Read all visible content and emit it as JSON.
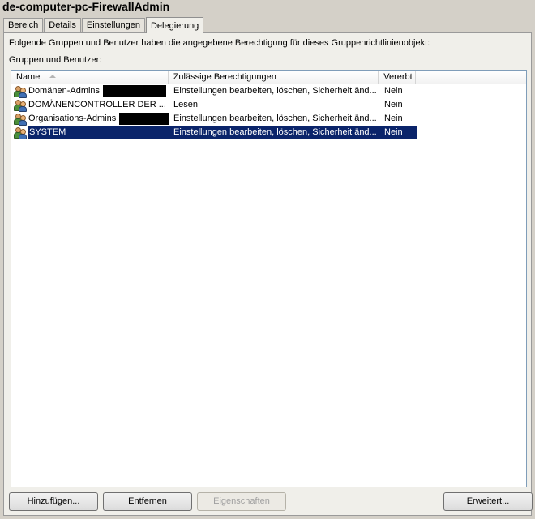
{
  "window": {
    "title": "de-computer-pc-FirewallAdmin"
  },
  "tabs": [
    {
      "label": "Bereich",
      "active": false
    },
    {
      "label": "Details",
      "active": false
    },
    {
      "label": "Einstellungen",
      "active": false
    },
    {
      "label": "Delegierung",
      "active": true
    }
  ],
  "panel": {
    "description": "Folgende Gruppen und Benutzer haben die angegebene Berechtigung für dieses Gruppenrichtlinienobjekt:",
    "list_label": "Gruppen und Benutzer:"
  },
  "list": {
    "columns": [
      {
        "label": "Name",
        "sorted": "ascending"
      },
      {
        "label": "Zulässige Berechtigungen"
      },
      {
        "label": "Vererbt"
      }
    ],
    "rows": [
      {
        "name": "Domänen-Admins",
        "redacted": true,
        "permission": "Einstellungen bearbeiten, löschen, Sicherheit änd...",
        "inherited": "Nein",
        "selected": false
      },
      {
        "name": "DOMÄNENCONTROLLER DER ...",
        "redacted": false,
        "permission": "Lesen",
        "inherited": "Nein",
        "selected": false
      },
      {
        "name": "Organisations-Admins",
        "redacted": true,
        "permission": "Einstellungen bearbeiten, löschen, Sicherheit änd...",
        "inherited": "Nein",
        "selected": false
      },
      {
        "name": "SYSTEM",
        "redacted": false,
        "permission": "Einstellungen bearbeiten, löschen, Sicherheit änd...",
        "inherited": "Nein",
        "selected": true
      }
    ],
    "row_icon": "group-users-icon",
    "selection_color": "#0a246a"
  },
  "buttons": {
    "add": "Hinzufügen...",
    "remove": "Entfernen",
    "properties": "Eigenschaften",
    "advanced": "Erweitert..."
  }
}
